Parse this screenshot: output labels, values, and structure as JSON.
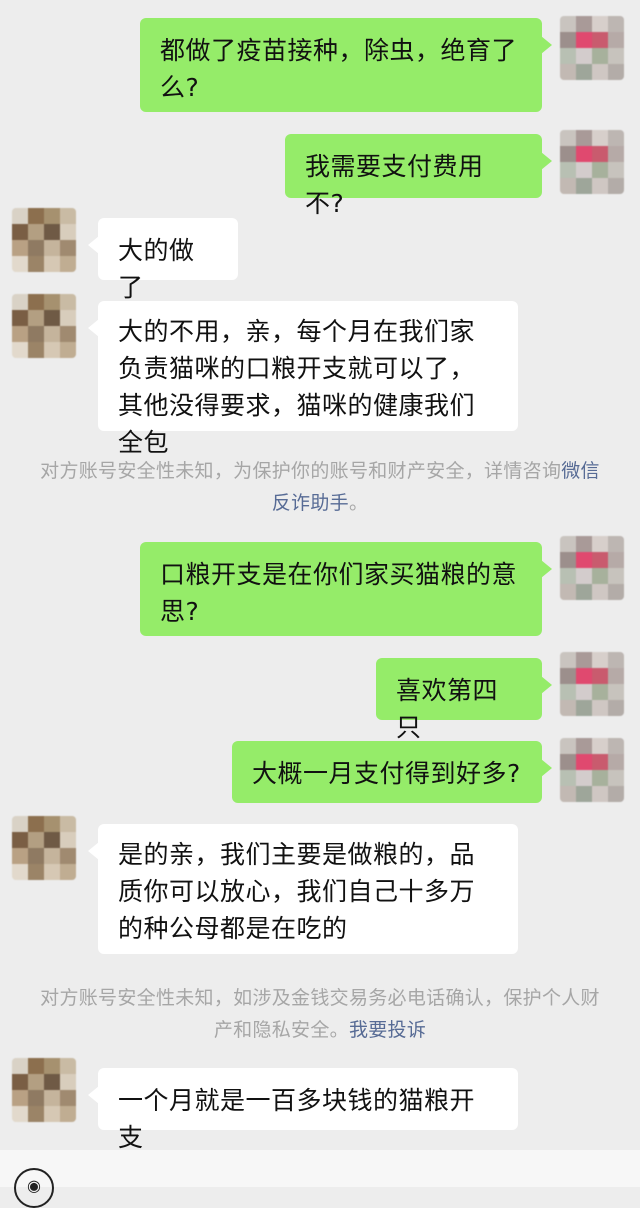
{
  "messages": [
    {
      "side": "out",
      "text": "都做了疫苗接种，除虫，绝育了么?"
    },
    {
      "side": "out",
      "text": "我需要支付费用不?"
    },
    {
      "side": "in",
      "text": "大的做了"
    },
    {
      "side": "in",
      "text": "大的不用，亲，每个月在我们家负责猫咪的口粮开支就可以了，其他没得要求，猫咪的健康我们全包"
    },
    {
      "side": "out",
      "text": "口粮开支是在你们家买猫粮的意思?"
    },
    {
      "side": "out",
      "text": "喜欢第四只"
    },
    {
      "side": "out",
      "text": "大概一月支付得到好多?"
    },
    {
      "side": "in",
      "text": "是的亲，我们主要是做粮的，品质你可以放心，我们自己十多万的种公母都是在吃的"
    },
    {
      "side": "in",
      "text": "一个月就是一百多块钱的猫粮开支"
    }
  ],
  "notices": [
    {
      "text": "对方账号安全性未知，为保护你的账号和财产安全，详情咨询",
      "link": "微信反诈助手",
      "suffix": "。"
    },
    {
      "text": "对方账号安全性未知，如涉及金钱交易务必电话确认，保护个人财产和隐私安全。",
      "link": "我要投诉",
      "suffix": ""
    }
  ],
  "colors": {
    "background": "#ededed",
    "outgoing_bubble": "#95ec69",
    "incoming_bubble": "#ffffff",
    "notice_text": "#a6a6a6",
    "notice_link": "#576b95"
  },
  "icons": {
    "voice": "voice-input-icon",
    "avatar_self": "pixelated-avatar",
    "avatar_other": "pixelated-avatar"
  }
}
